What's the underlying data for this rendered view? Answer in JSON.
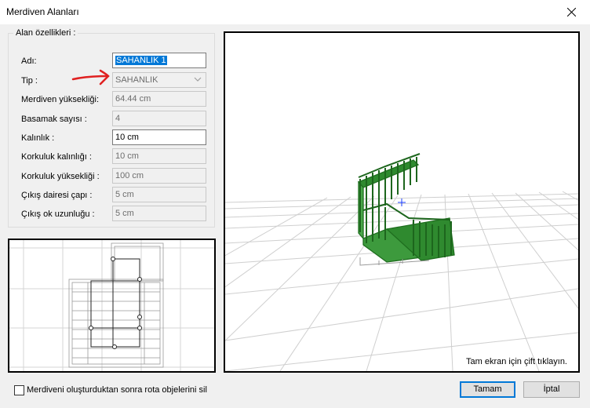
{
  "window": {
    "title": "Merdiven Alanları"
  },
  "properties": {
    "legend": "Alan özellikleri :",
    "rows": [
      {
        "label": "Adı:",
        "value": "SAHANLIK 1"
      },
      {
        "label": "Tip :",
        "value": "SAHANLIK"
      },
      {
        "label": "Merdiven yüksekliği:",
        "value": "64.44 cm"
      },
      {
        "label": "Basamak sayısı :",
        "value": "4"
      },
      {
        "label": "Kalınlık :",
        "value": "10 cm"
      },
      {
        "label": "Korkuluk kalınlığı :",
        "value": "10 cm"
      },
      {
        "label": "Korkuluk yüksekliği :",
        "value": "100 cm"
      },
      {
        "label": "Çıkış dairesi çapı :",
        "value": "5 cm"
      },
      {
        "label": "Çıkış ok uzunluğu :",
        "value": "5 cm"
      }
    ]
  },
  "viewport": {
    "hint": "Tam ekran için çift tıklayın."
  },
  "footer": {
    "checkbox_label": "Merdiveni oluşturduktan sonra rota objelerini sil",
    "checkbox_checked": false,
    "ok_label": "Tamam",
    "cancel_label": "İptal"
  },
  "colors": {
    "accent": "#0078d7",
    "stair_green": "#2e8b2e",
    "annotation_red": "#e02020"
  }
}
